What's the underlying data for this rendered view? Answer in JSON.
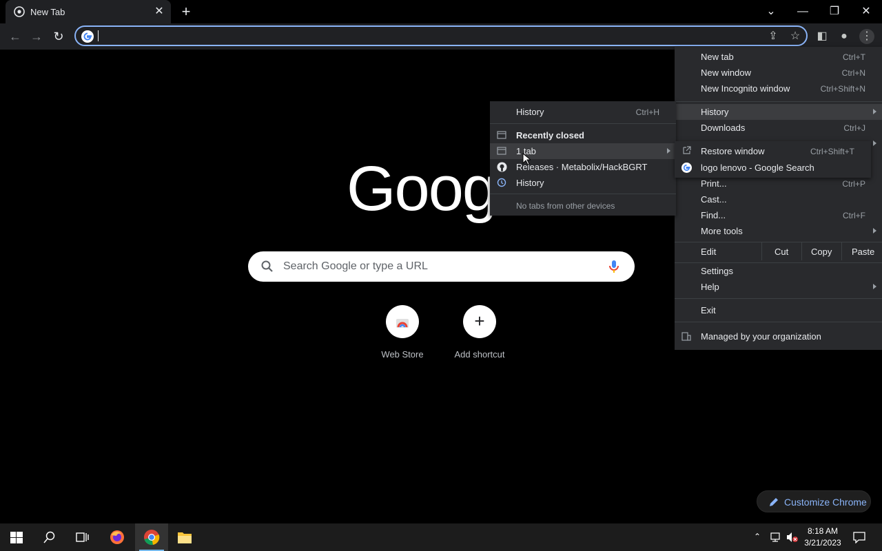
{
  "tab": {
    "title": "New Tab",
    "close_icon": "close-icon"
  },
  "omnibox": {
    "value": ""
  },
  "ntp": {
    "logo_text": "Goog",
    "search_placeholder": "Search Google or type a URL",
    "shortcuts": [
      {
        "label": "Web Store"
      },
      {
        "label": "Add shortcut"
      }
    ],
    "customize_label": "Customize Chrome"
  },
  "chrome_menu": {
    "items": [
      {
        "label": "New tab",
        "shortcut": "Ctrl+T"
      },
      {
        "label": "New window",
        "shortcut": "Ctrl+N"
      },
      {
        "label": "New Incognito window",
        "shortcut": "Ctrl+Shift+N"
      },
      {
        "label": "History",
        "shortcut": ""
      },
      {
        "label": "Downloads",
        "shortcut": "Ctrl+J"
      },
      {
        "label": "Print...",
        "shortcut": "Ctrl+P"
      },
      {
        "label": "Cast...",
        "shortcut": ""
      },
      {
        "label": "Find...",
        "shortcut": "Ctrl+F"
      },
      {
        "label": "More tools",
        "shortcut": ""
      }
    ],
    "edit": {
      "label": "Edit",
      "cut": "Cut",
      "copy": "Copy",
      "paste": "Paste"
    },
    "settings": "Settings",
    "help": "Help",
    "exit": "Exit",
    "managed": "Managed by your organization"
  },
  "history_menu": {
    "history": {
      "label": "History",
      "shortcut": "Ctrl+H"
    },
    "recently_closed": "Recently closed",
    "items": [
      {
        "label": "1 tab"
      },
      {
        "label": "Releases · Metabolix/HackBGRT"
      },
      {
        "label": "History"
      }
    ],
    "no_tabs": "No tabs from other devices"
  },
  "tab_submenu": {
    "restore": {
      "label": "Restore window",
      "shortcut": "Ctrl+Shift+T"
    },
    "entry": "logo lenovo - Google Search"
  },
  "taskbar": {
    "time": "8:18 AM",
    "date": "3/21/2023"
  }
}
